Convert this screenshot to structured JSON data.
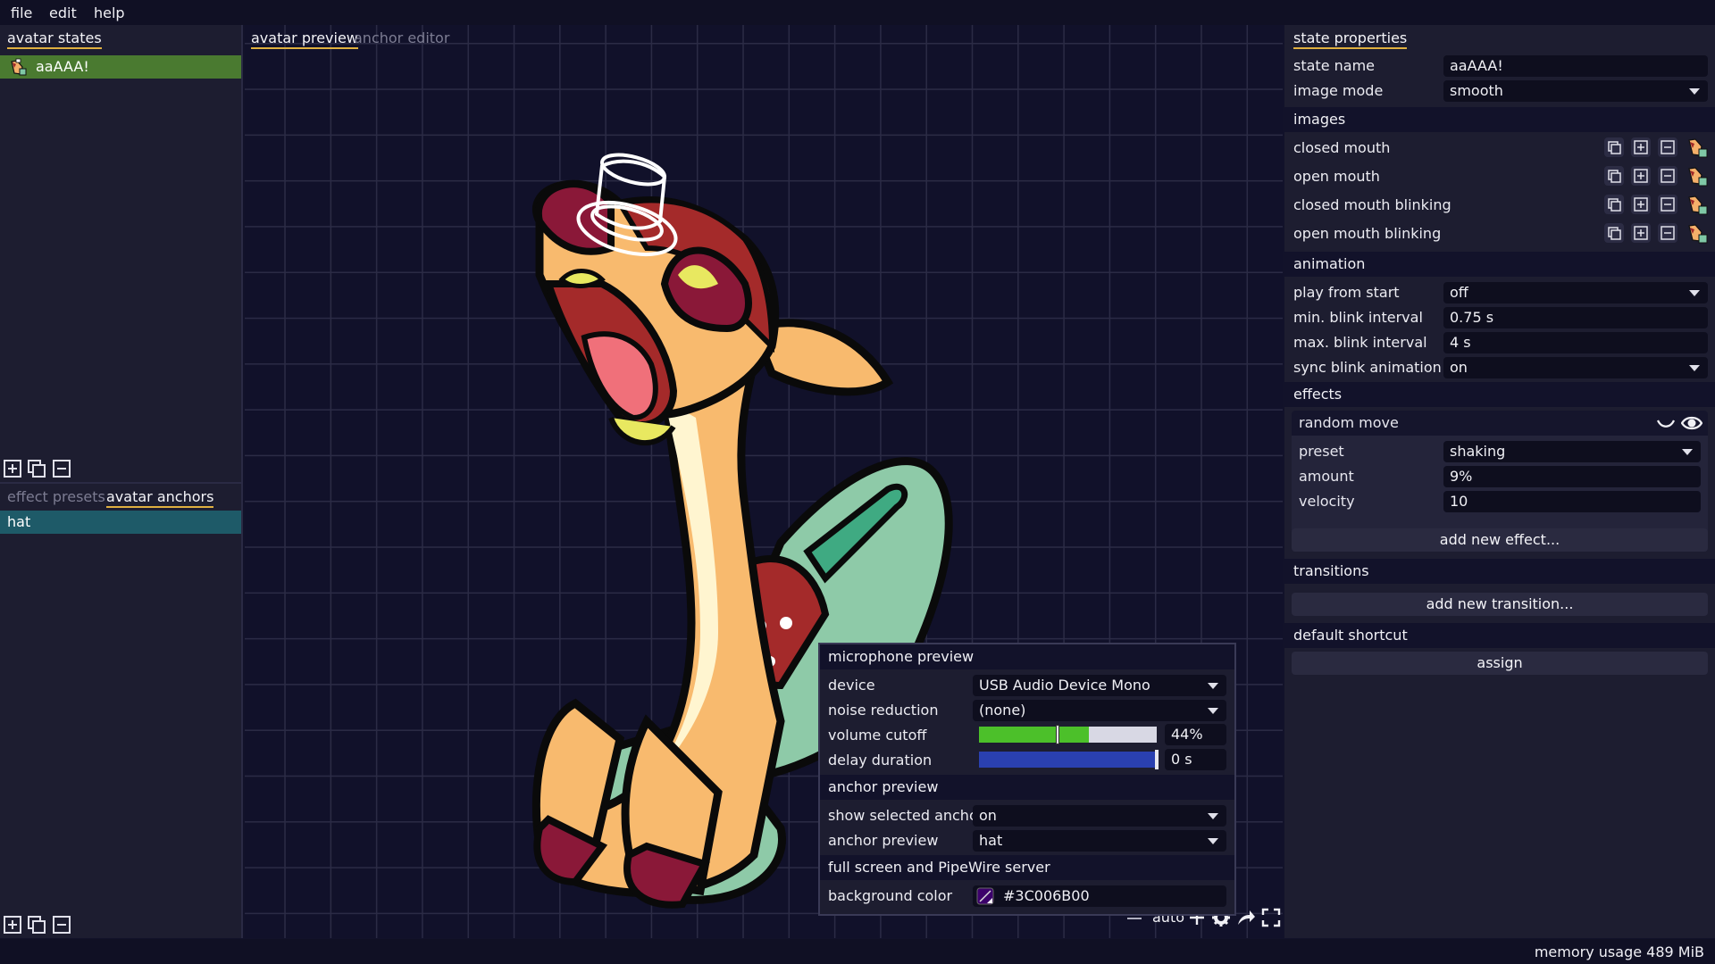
{
  "menu": {
    "file": "file",
    "edit": "edit",
    "help": "help"
  },
  "left": {
    "states_tab": "avatar states",
    "states": [
      {
        "name": "aaAAA!"
      }
    ],
    "bottom_tabs": {
      "presets": "effect presets",
      "anchors": "avatar anchors"
    },
    "anchors": [
      {
        "name": "hat"
      }
    ]
  },
  "center": {
    "tabs": {
      "preview": "avatar preview",
      "anchor_editor": "anchor editor"
    },
    "zoom": {
      "label": "auto"
    }
  },
  "mic": {
    "title": "microphone preview",
    "device_label": "device",
    "device_value": "USB Audio Device Mono",
    "noise_label": "noise reduction",
    "noise_value": "(none)",
    "volume_label": "volume cutoff",
    "volume_value": "44%",
    "volume_fraction": 0.44,
    "delay_label": "delay duration",
    "delay_value": "0 s",
    "anchor_title": "anchor preview",
    "show_anchor_label": "show selected anchor",
    "show_anchor_value": "on",
    "anchor_preview_label": "anchor preview",
    "anchor_preview_value": "hat",
    "fullscreen_title": "full screen and PipeWire server",
    "bg_label": "background color",
    "bg_value": "#3C006B00"
  },
  "right": {
    "tab": "state properties",
    "state_name_label": "state name",
    "state_name_value": "aaAAA!",
    "image_mode_label": "image mode",
    "image_mode_value": "smooth",
    "images_head": "images",
    "images": [
      {
        "label": "closed mouth"
      },
      {
        "label": "open mouth"
      },
      {
        "label": "closed mouth blinking"
      },
      {
        "label": "open mouth blinking"
      }
    ],
    "animation_head": "animation",
    "play_label": "play from start",
    "play_value": "off",
    "min_blink_label": "min. blink interval",
    "min_blink_value": "0.75 s",
    "max_blink_label": "max. blink interval",
    "max_blink_value": "4 s",
    "sync_label": "sync blink animation",
    "sync_value": "on",
    "effects_head": "effects",
    "effect_name": "random move",
    "preset_label": "preset",
    "preset_value": "shaking",
    "amount_label": "amount",
    "amount_value": "9%",
    "velocity_label": "velocity",
    "velocity_value": "10",
    "add_effect": "add new effect...",
    "transitions_head": "transitions",
    "add_transition": "add new transition...",
    "shortcut_head": "default shortcut",
    "assign": "assign"
  },
  "status": {
    "memory": "memory usage 489 MiB"
  },
  "colors": {
    "accent_underline": "#e0b040",
    "selected_state": "#4a7a30",
    "selected_anchor": "#1e5a68",
    "volume_fill": "#4cc02a",
    "delay_fill": "#2a40b0"
  }
}
